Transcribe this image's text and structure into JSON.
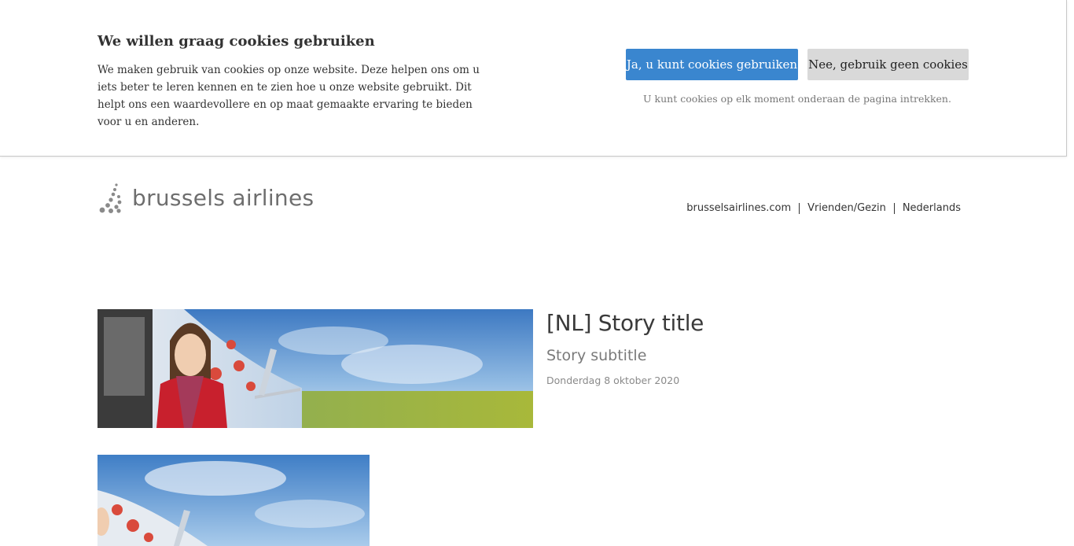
{
  "cookie_banner": {
    "title": "We willen graag cookies gebruiken",
    "text": "We maken gebruik van cookies op onze website. Deze helpen ons om u iets beter te leren kennen en te zien hoe u onze website gebruikt. Dit helpt ons een waardevollere en op maat gemaakte ervaring te bieden voor u en anderen.",
    "accept_label": "Ja, u kunt cookies gebruiken",
    "decline_label": "Nee, gebruik geen cookies",
    "note": "U kunt cookies op elk moment onderaan de pagina intrekken.",
    "accept_color": "#3a86cf",
    "decline_color": "#d9d9d9"
  },
  "header": {
    "logo_text": "brussels airlines",
    "logo_icon": "dotted-b-icon",
    "nav": [
      {
        "label": "brusselsairlines.com"
      },
      {
        "label": "Vrienden/Gezin"
      },
      {
        "label": "Nederlands"
      }
    ]
  },
  "story": {
    "title": "[NL] Story title",
    "subtitle": "Story subtitle",
    "date": "Donderdag 8 oktober 2020"
  },
  "colors": {
    "logo_gray": "#6e6e6e",
    "logo_red": "#d8322e"
  }
}
